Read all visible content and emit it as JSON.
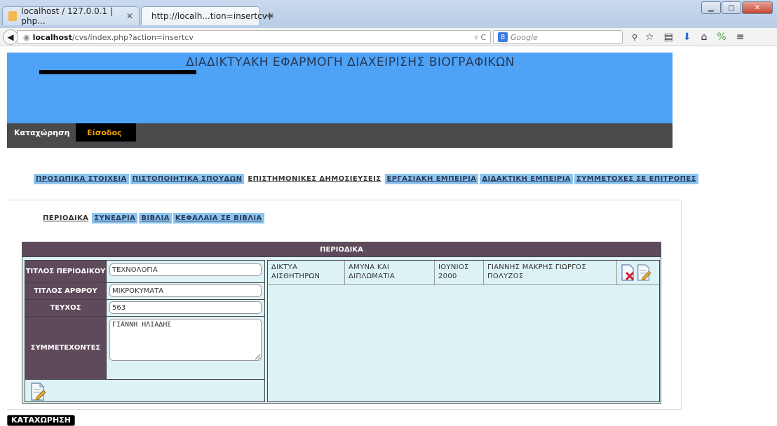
{
  "browser": {
    "tabs": [
      {
        "title": "localhost / 127.0.0.1 | php...",
        "favicon_color": "#f2b84b"
      },
      {
        "title": "http://localh...tion=insertcv",
        "favicon_color": "#e8704a"
      }
    ],
    "url_host": "localhost",
    "url_path": "/cvs/index.php?action=insertcv",
    "search_placeholder": "Google"
  },
  "header": {
    "title": "ΔΙΑΔΙΚΤΥΑΚΗ ΕΦΑΡΜΟΓΗ ΔΙΑΧΕΙΡΙΣΗΣ ΒΙΟΓΡΑΦΙΚΩΝ",
    "color": "#4fa3f7"
  },
  "menu": {
    "register": "Καταχώρηση",
    "login": "Είσοδος"
  },
  "section_tabs": [
    "ΠΡΟΣΩΠΙΚΑ ΣΤΟΙΧΕΙΑ",
    "ΠΙΣΤΟΠΟΙΗΤΙΚΑ ΣΠΟΥΔΩΝ",
    "ΕΠΙΣΤΗΜΟΝΙΚΕΣ ΔΗΜΟΣΙΕΥΣΕΙΣ",
    "ΕΡΓΑΣΙΑΚΗ ΕΜΠΕΙΡΙΑ",
    "ΔΙΔΑΚΤΙΚΗ ΕΜΠΕΙΡΙΑ",
    "ΣΥΜΜΕΤΟΧΕΣ ΣΕ ΕΠΙΤΡΟΠΕΣ"
  ],
  "sub_tabs": [
    "ΠΕΡΙΟΔΙΚΑ",
    "ΣΥΝΕΔΡΙΑ",
    "ΒΙΒΛΙΑ",
    "ΚΕΦΑΛΑΙΑ ΣΕ ΒΙΒΛΙΑ"
  ],
  "panel": {
    "title": "ΠΕΡΙΟΔΙΚΑ",
    "form": {
      "journal_title_label": "ΤΙΤΛΟΣ ΠΕΡΙΟΔΙΚΟΥ",
      "journal_title_value": "ΤΕΧΝΟΛΟΓΙΑ",
      "article_title_label": "ΤΙΤΛΟΣ ΑΡΘΡΟΥ",
      "article_title_value": "ΜΙΚΡΟΚΥΜΑΤΑ",
      "issue_label": "ΤΕΥΧΟΣ",
      "issue_value": "563",
      "participants_label": "ΣΥΜΜΕΤΕΧΟΝΤΕΣ",
      "participants_value": "ΓΙΑΝΝΗ ΗΛΙΑΔΗΣ"
    },
    "entries": [
      {
        "journal": "ΔΙΚΤΥΑ ΑΙΣΘΗΤΗΡΩΝ",
        "article": "ΑΜΥΝΑ ΚΑΙ ΔΙΠΛΩΜΑΤΙΑ",
        "issue": "ΙΟΥΝΙΟΣ 2000",
        "participants": "ΓΙΑΝΝΗΣ ΜΑΚΡΗΣ ΓΙΩΡΓΟΣ ΠΟΛΥΖΟΣ"
      }
    ]
  },
  "submit_label": "ΚΑΤΑΧΩΡΗΣΗ"
}
